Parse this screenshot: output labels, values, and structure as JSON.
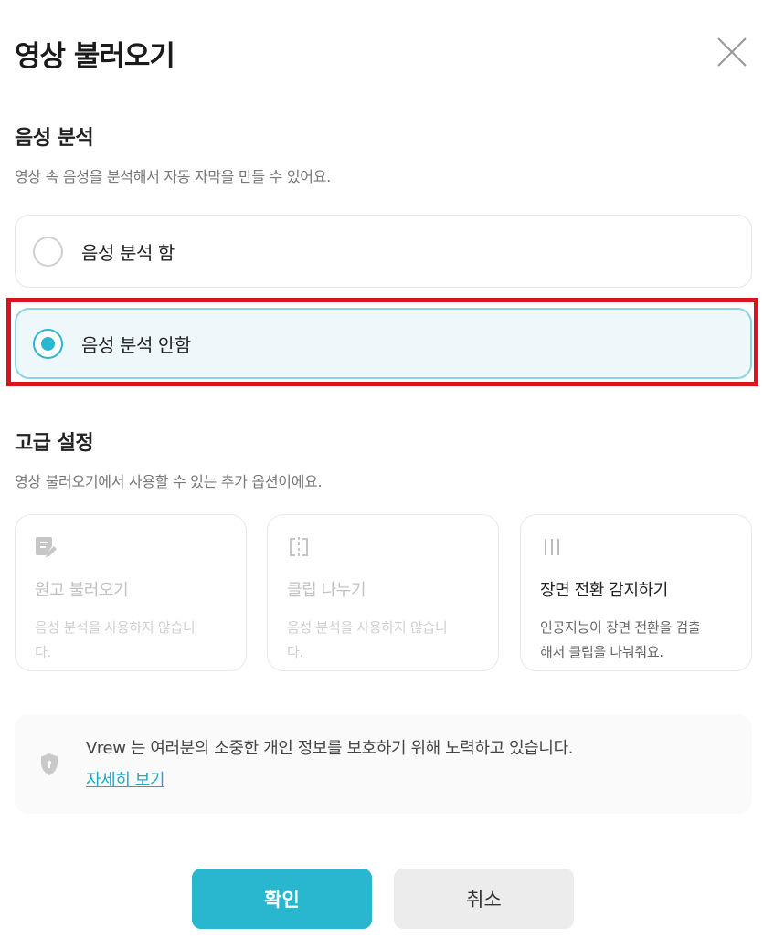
{
  "dialog": {
    "title": "영상 불러오기"
  },
  "voice_analysis": {
    "heading": "음성 분석",
    "description": "영상 속 음성을 분석해서 자동 자막을 만들 수 있어요.",
    "options": [
      {
        "label": "음성 분석 함",
        "selected": false
      },
      {
        "label": "음성 분석 안함",
        "selected": true
      }
    ]
  },
  "advanced": {
    "heading": "고급 설정",
    "description": "영상 불러오기에서 사용할 수 있는 추가 옵션이에요.",
    "cards": [
      {
        "icon": "script-edit-icon",
        "title": "원고 불러오기",
        "desc_line1": "음성 분석을 사용하지 않습니",
        "desc_line2": "다.",
        "enabled": false
      },
      {
        "icon": "clip-split-icon",
        "title": "클립 나누기",
        "desc_line1": "음성 분석을 사용하지 않습니",
        "desc_line2": "다.",
        "enabled": false
      },
      {
        "icon": "scene-detect-icon",
        "title": "장면 전환 감지하기",
        "desc_line1": "인공지능이 장면 전환을 검출",
        "desc_line2": "해서 클립을 나눠줘요.",
        "enabled": true
      }
    ]
  },
  "privacy_notice": {
    "text": "Vrew 는 여러분의 소중한 개인 정보를 보호하기 위해 노력하고 있습니다.",
    "link": "자세히 보기"
  },
  "actions": {
    "confirm": "확인",
    "cancel": "취소"
  },
  "colors": {
    "accent": "#29b6cf",
    "highlight_border": "#d9141f"
  }
}
